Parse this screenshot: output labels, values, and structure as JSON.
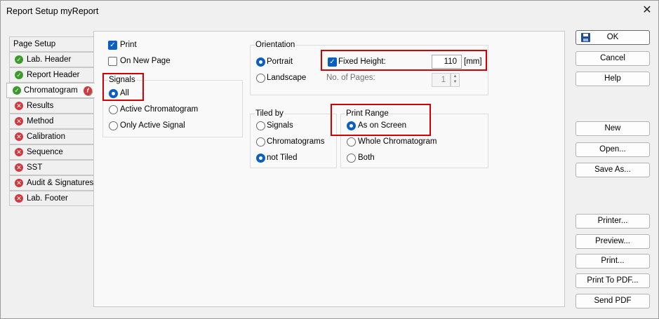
{
  "window": {
    "title": "Report Setup myReport",
    "close_icon": "close-icon"
  },
  "tabs": [
    {
      "label": "Page Setup",
      "status": "none"
    },
    {
      "label": "Lab. Header",
      "status": "ok"
    },
    {
      "label": "Report Header",
      "status": "ok"
    },
    {
      "label": "Chromatogram",
      "status": "ok",
      "flag": "f"
    },
    {
      "label": "Results",
      "status": "error"
    },
    {
      "label": "Method",
      "status": "error"
    },
    {
      "label": "Calibration",
      "status": "error"
    },
    {
      "label": "Sequence",
      "status": "error"
    },
    {
      "label": "SST",
      "status": "error"
    },
    {
      "label": "Audit & Signatures",
      "status": "error"
    },
    {
      "label": "Lab. Footer",
      "status": "error"
    }
  ],
  "page": {
    "print_label": "Print",
    "print_checked": true,
    "new_page_label": "On New Page",
    "new_page_checked": false,
    "signals": {
      "title": "Signals",
      "options": [
        "All",
        "Active Chromatogram",
        "Only Active Signal"
      ],
      "selected": "All"
    },
    "orientation": {
      "title": "Orientation",
      "options": [
        "Portrait",
        "Landscape"
      ],
      "selected": "Portrait",
      "fixed_height_label": "Fixed Height:",
      "fixed_height_checked": true,
      "fixed_height_value": "110",
      "fixed_height_unit": "[mm]",
      "pages_label": "No. of Pages:",
      "pages_value": "1"
    },
    "tiled_by": {
      "title": "Tiled by",
      "options": [
        "Signals",
        "Chromatograms",
        "not Tiled"
      ],
      "selected": "not Tiled"
    },
    "print_range": {
      "title": "Print Range",
      "options": [
        "As on Screen",
        "Whole Chromatogram",
        "Both"
      ],
      "selected": "As on Screen"
    }
  },
  "buttons": {
    "ok": "OK",
    "cancel": "Cancel",
    "help": "Help",
    "new": "New",
    "open": "Open...",
    "save_as": "Save As...",
    "printer": "Printer...",
    "preview": "Preview...",
    "print": "Print...",
    "print_pdf": "Print To PDF...",
    "send_pdf": "Send PDF"
  },
  "colors": {
    "accent": "#0b5fc1",
    "highlight": "#d40000",
    "ok": "#3c9a2c",
    "error": "#d0393e"
  }
}
